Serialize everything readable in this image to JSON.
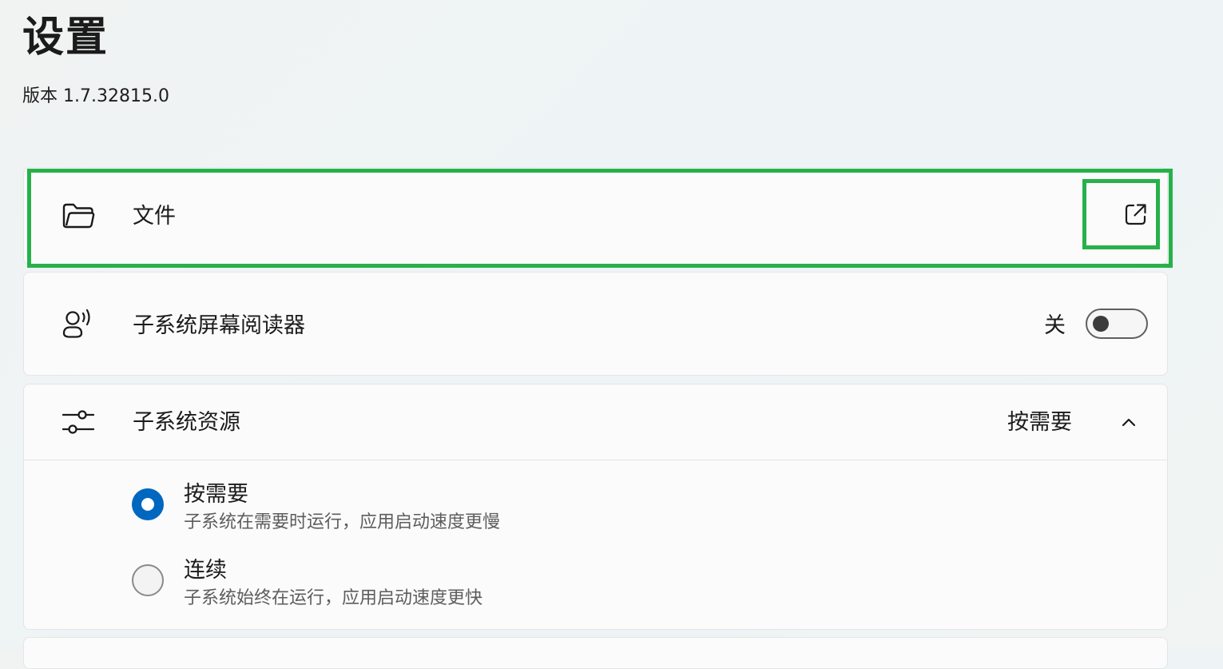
{
  "page": {
    "title": "设置",
    "version": "版本 1.7.32815.0"
  },
  "files": {
    "label": "文件",
    "icon": "folder-icon",
    "action_icon": "open-external-icon"
  },
  "screen_reader": {
    "label": "子系统屏幕阅读器",
    "icon": "narrator-icon",
    "state_label": "关",
    "toggle_on": false
  },
  "resources": {
    "label": "子系统资源",
    "icon": "sliders-icon",
    "selected_value": "按需要",
    "expanded": true,
    "options": [
      {
        "title": "按需要",
        "description": "子系统在需要时运行，应用启动速度更慢",
        "selected": true
      },
      {
        "title": "连续",
        "description": "子系统始终在运行，应用启动速度更快",
        "selected": false
      }
    ]
  },
  "colors": {
    "accent": "#0067c0",
    "highlight": "#27b14b",
    "card_background": "#fbfbfb"
  }
}
